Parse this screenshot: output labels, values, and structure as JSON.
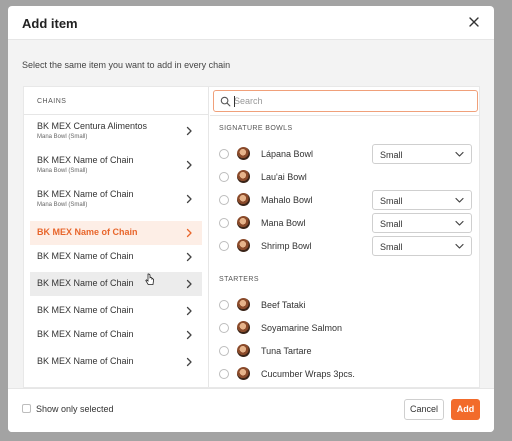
{
  "modal": {
    "title": "Add item",
    "instruction": "Select the same item you want to add in every chain"
  },
  "chains": {
    "header": "CHAINS",
    "items": [
      {
        "name": "BK MEX Centura Alimentos",
        "sub": "Mana Bowl (Small)",
        "state": "normal"
      },
      {
        "name": "BK MEX Name of Chain",
        "sub": "Mana Bowl (Small)",
        "state": "normal"
      },
      {
        "name": "BK MEX Name of Chain",
        "sub": "Mana Bowl (Small)",
        "state": "normal"
      },
      {
        "name": "BK MEX Name of Chain",
        "sub": "",
        "state": "selected"
      },
      {
        "name": "BK MEX Name of Chain",
        "sub": "",
        "state": "normal"
      },
      {
        "name": "BK MEX Name of Chain",
        "sub": "",
        "state": "hover"
      },
      {
        "name": "BK MEX Name of Chain",
        "sub": "",
        "state": "normal"
      },
      {
        "name": "BK MEX Name of Chain",
        "sub": "",
        "state": "normal"
      },
      {
        "name": "BK MEX Name of Chain",
        "sub": "",
        "state": "normal"
      }
    ]
  },
  "search": {
    "placeholder": "Search",
    "value": ""
  },
  "sections": [
    {
      "title": "SIGNATURE BOWLS",
      "items": [
        {
          "name": "Lápana Bowl",
          "size": "Small"
        },
        {
          "name": "Lau'ai Bowl",
          "size": ""
        },
        {
          "name": "Mahalo Bowl",
          "size": "Small"
        },
        {
          "name": "Mana Bowl",
          "size": "Small"
        },
        {
          "name": "Shrimp Bowl",
          "size": "Small"
        }
      ]
    },
    {
      "title": "STARTERS",
      "items": [
        {
          "name": "Beef Tataki",
          "size": ""
        },
        {
          "name": "Soyamarine Salmon",
          "size": ""
        },
        {
          "name": "Tuna Tartare",
          "size": ""
        },
        {
          "name": "Cucumber Wraps 3pcs.",
          "size": ""
        }
      ]
    }
  ],
  "footer": {
    "show_only_selected": "Show only selected",
    "cancel": "Cancel",
    "add": "Add"
  },
  "colors": {
    "accent": "#f26b2b",
    "selected_bg": "#fdeee6",
    "selected_text": "#e8662c"
  },
  "icons": {
    "close": "close-icon",
    "chevron": "chevron-right-icon",
    "search": "search-icon",
    "dropdown": "chevron-down-icon",
    "cursor": "mouse-pointer-icon"
  }
}
